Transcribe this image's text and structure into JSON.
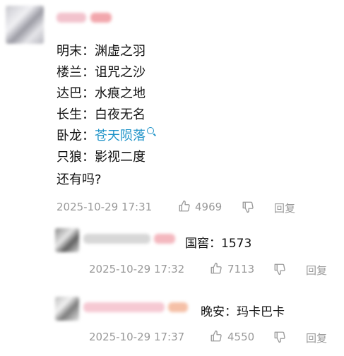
{
  "main_comment": {
    "lines": [
      {
        "label": "明末：",
        "value": "渊虚之羽"
      },
      {
        "label": "楼兰：",
        "value": "诅咒之沙"
      },
      {
        "label": "达巴：",
        "value": "水痕之地"
      },
      {
        "label": "长生：",
        "value": "白夜无名"
      },
      {
        "label": "卧龙：",
        "value": "苍天陨落",
        "is_link": true
      },
      {
        "label": "只狼：",
        "value": "影视二度"
      }
    ],
    "closing": "还有吗?",
    "timestamp": "2025-10-29 17:31",
    "likes": "4969",
    "reply_label": "回复"
  },
  "replies": [
    {
      "text": "国窖：1573",
      "timestamp": "2025-10-29 17:32",
      "likes": "7113",
      "reply_label": "回复"
    },
    {
      "text": "晚安：玛卡巴卡",
      "timestamp": "2025-10-29 17:37",
      "likes": "4550",
      "reply_label": "回复"
    }
  ],
  "colors": {
    "link": "#1f93c8",
    "meta": "#999999"
  }
}
